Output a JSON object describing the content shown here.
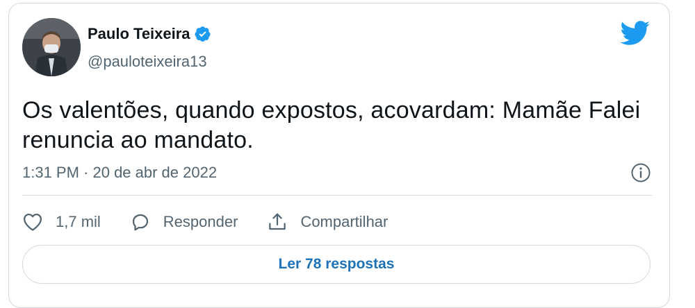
{
  "author": {
    "name": "Paulo Teixeira",
    "handle": "@pauloteixeira13",
    "verified_color": "#1d9bf0"
  },
  "brand": {
    "icon": "twitter-bird-icon",
    "color": "#1d9bf0"
  },
  "tweet": {
    "text": "Os valentões, quando expostos, acovardam: Mamãe Falei renuncia ao mandato.",
    "timestamp": "1:31 PM · 20 de abr de 2022"
  },
  "actions": {
    "like_count": "1,7 mil",
    "reply_label": "Responder",
    "share_label": "Compartilhar"
  },
  "replies_button": "Ler 78 respostas",
  "colors": {
    "text": "#0f1419",
    "secondary": "#536471",
    "border": "#cfd9de",
    "link": "#1d72b8"
  }
}
